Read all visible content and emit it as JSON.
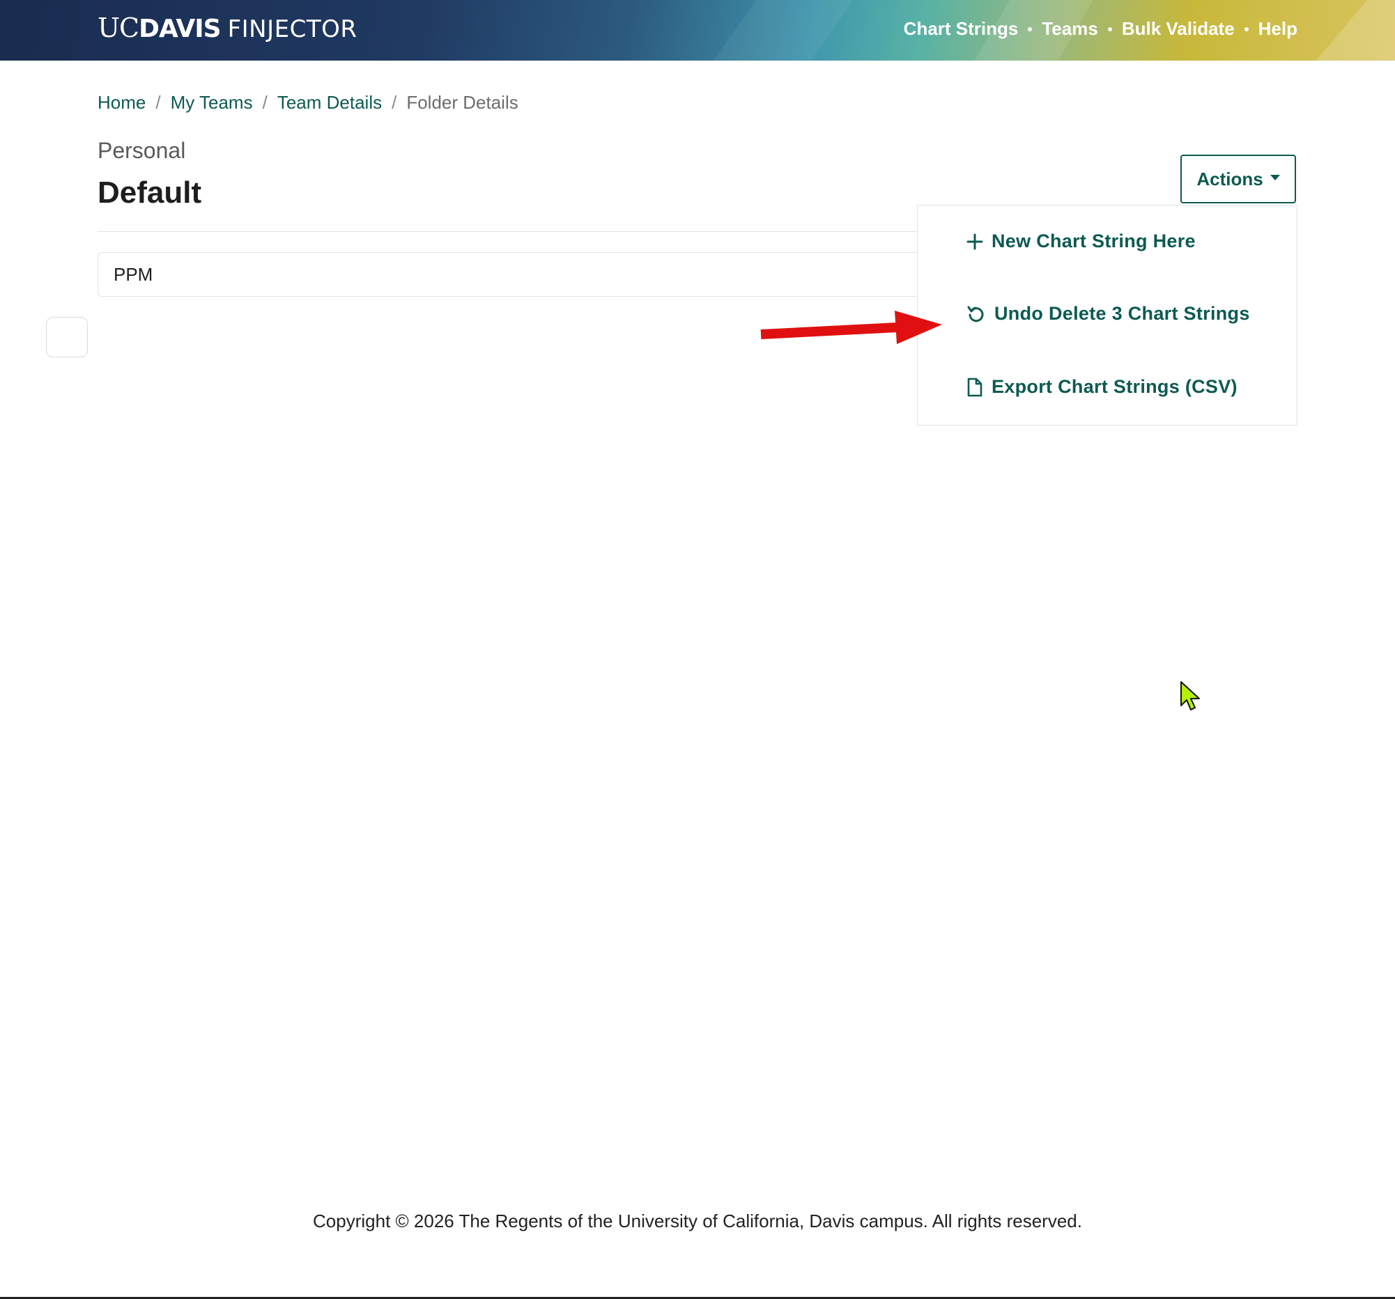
{
  "header": {
    "logo_uc": "UC",
    "logo_davis": "DAVIS",
    "logo_app": "FINJECTOR",
    "nav": [
      {
        "label": "Chart Strings"
      },
      {
        "label": "Teams"
      },
      {
        "label": "Bulk Validate"
      },
      {
        "label": "Help"
      }
    ]
  },
  "breadcrumb": {
    "items": [
      {
        "label": "Home"
      },
      {
        "label": "My Teams"
      },
      {
        "label": "Team Details"
      }
    ],
    "current": "Folder Details",
    "separator": "/"
  },
  "page": {
    "subtitle": "Personal",
    "title": "Default",
    "actions_label": "Actions"
  },
  "folder": {
    "rows": [
      {
        "label": "PPM"
      }
    ]
  },
  "actions_menu": {
    "items": [
      {
        "label": "New Chart String Here",
        "icon": "plus-icon"
      },
      {
        "label": "Undo Delete 3 Chart Strings",
        "icon": "undo-icon"
      },
      {
        "label": "Export Chart Strings (CSV)",
        "icon": "file-icon"
      }
    ]
  },
  "footer": {
    "copyright": "Copyright © 2026 The Regents of the University of California, Davis campus. All rights reserved."
  },
  "colors": {
    "brand_green": "#0d5a52",
    "header_navy": "#1a2b4f",
    "header_gold": "#d9c460",
    "annotation_red": "#e01010",
    "cursor_lime": "#b5f000"
  }
}
